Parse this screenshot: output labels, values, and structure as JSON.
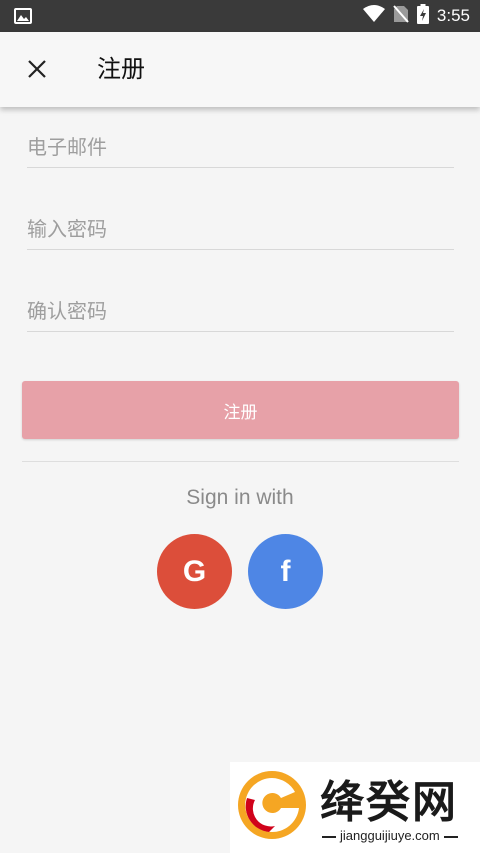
{
  "status_bar": {
    "time": "3:55"
  },
  "app_bar": {
    "title": "注册"
  },
  "form": {
    "email_placeholder": "电子邮件",
    "password_placeholder": "输入密码",
    "confirm_placeholder": "确认密码",
    "submit_label": "注册"
  },
  "signin": {
    "label": "Sign in with",
    "google_letter": "G",
    "facebook_letter": "f"
  },
  "watermark": {
    "title": "绛癸网",
    "url": "jiangguijiuye.com"
  },
  "colors": {
    "submit_button": "#e7a1a8",
    "google": "#dc4e3a",
    "facebook": "#4e86e5"
  }
}
